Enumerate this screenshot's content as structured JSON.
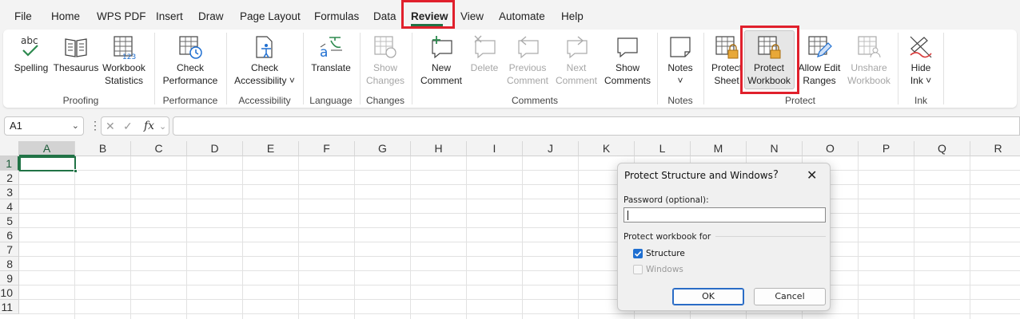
{
  "tabs": [
    {
      "label": "File"
    },
    {
      "label": "Home"
    },
    {
      "label": "WPS PDF"
    },
    {
      "label": "Insert"
    },
    {
      "label": "Draw"
    },
    {
      "label": "Page Layout"
    },
    {
      "label": "Formulas"
    },
    {
      "label": "Data"
    },
    {
      "label": "Review"
    },
    {
      "label": "View"
    },
    {
      "label": "Automate"
    },
    {
      "label": "Help"
    }
  ],
  "active_tab": "Review",
  "ribbon": {
    "spelling": "Spelling",
    "spelling_icon_text": "abc",
    "thesaurus": "Thesaurus",
    "workbook_statistics_1": "Workbook",
    "workbook_statistics_2": "Statistics",
    "workbook_statistics_icon_text": "123",
    "proofing_group": "Proofing",
    "check_performance_1": "Check",
    "check_performance_2": "Performance",
    "performance_group": "Performance",
    "check_accessibility_1": "Check",
    "check_accessibility_2": "Accessibility",
    "accessibility_group": "Accessibility",
    "translate": "Translate",
    "language_group": "Language",
    "show_changes_1": "Show",
    "show_changes_2": "Changes",
    "changes_group": "Changes",
    "new_comment_1": "New",
    "new_comment_2": "Comment",
    "delete": "Delete",
    "previous_comment_1": "Previous",
    "previous_comment_2": "Comment",
    "next_comment_1": "Next",
    "next_comment_2": "Comment",
    "show_comments_1": "Show",
    "show_comments_2": "Comments",
    "comments_group": "Comments",
    "notes": "Notes",
    "notes_group": "Notes",
    "protect_sheet_1": "Protect",
    "protect_sheet_2": "Sheet",
    "protect_workbook_1": "Protect",
    "protect_workbook_2": "Workbook",
    "allow_edit_ranges_1": "Allow Edit",
    "allow_edit_ranges_2": "Ranges",
    "unshare_workbook_1": "Unshare",
    "unshare_workbook_2": "Workbook",
    "protect_group": "Protect",
    "hide_ink_1": "Hide",
    "hide_ink_2": "Ink",
    "ink_group": "Ink"
  },
  "formula_bar": {
    "name_box": "A1",
    "fx": "fx",
    "formula": ""
  },
  "grid": {
    "columns": [
      "A",
      "B",
      "C",
      "D",
      "E",
      "F",
      "G",
      "H",
      "I",
      "J",
      "K",
      "L",
      "M",
      "N",
      "O",
      "P",
      "Q",
      "R"
    ],
    "rows": [
      "1",
      "2",
      "3",
      "4",
      "5",
      "6",
      "7",
      "8",
      "9",
      "10",
      "11"
    ],
    "active_cell": "A1"
  },
  "dialog": {
    "title": "Protect Structure and Windows",
    "help": "?",
    "close": "✕",
    "password_label": "Password (optional):",
    "password_value": "",
    "protect_for_label": "Protect workbook for",
    "structure_label": "Structure",
    "structure_checked": true,
    "windows_label": "Windows",
    "windows_checked": false,
    "ok": "OK",
    "cancel": "Cancel"
  },
  "colors": {
    "accent": "#217346",
    "highlight": "#e0202c",
    "checkbox": "#1f6fd1"
  }
}
